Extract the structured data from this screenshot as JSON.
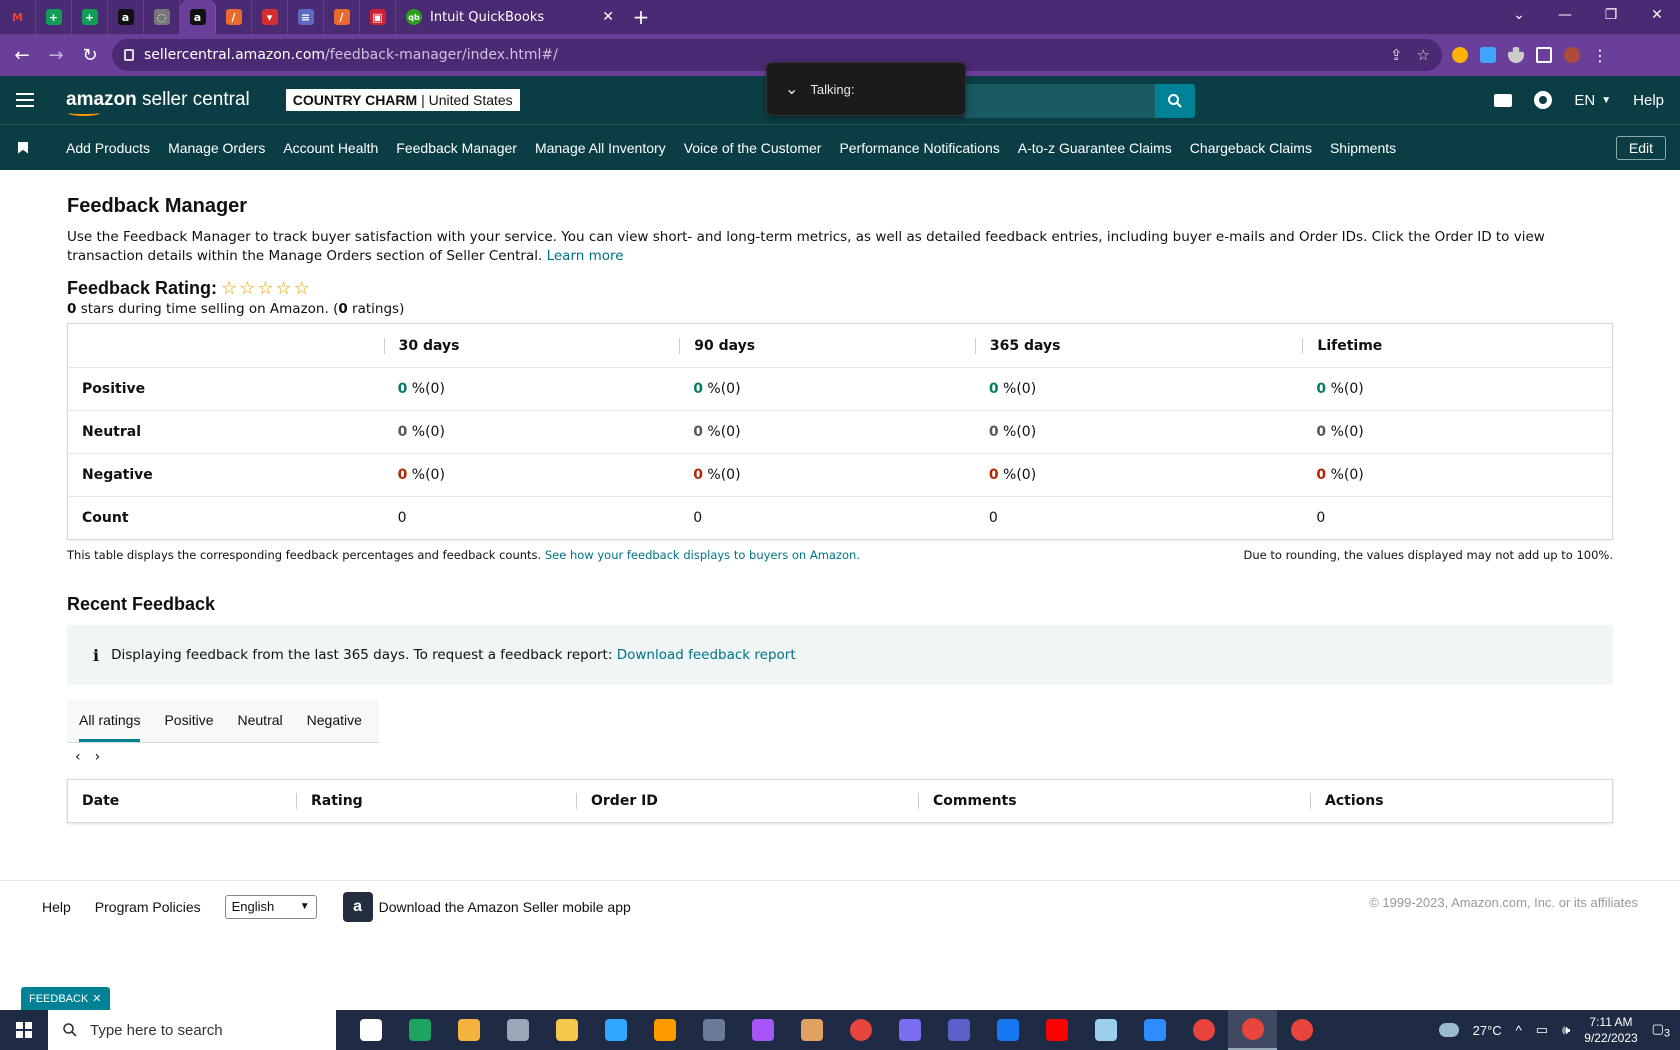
{
  "browser": {
    "active_tab_title": "Intuit QuickBooks",
    "url_host": "sellercentral.amazon.com",
    "url_path": "/feedback-manager/index.html#/",
    "mini_tabs": [
      {
        "icon": "gmail-icon",
        "color": "#ffffff",
        "glyph": "M"
      },
      {
        "icon": "sheets-icon",
        "color": "#0f9d58",
        "glyph": "+"
      },
      {
        "icon": "sheets-icon",
        "color": "#0f9d58",
        "glyph": "+"
      },
      {
        "icon": "amazon-icon",
        "color": "#111111",
        "glyph": "a"
      },
      {
        "icon": "loading-icon",
        "color": "#777777",
        "glyph": "◌"
      },
      {
        "icon": "amazon-icon",
        "color": "#111111",
        "glyph": "a"
      },
      {
        "icon": "app-icon",
        "color": "#e86a2c",
        "glyph": "/"
      },
      {
        "icon": "app-icon",
        "color": "#d32f2f",
        "glyph": "▾"
      },
      {
        "icon": "list-icon",
        "color": "#5c6bc0",
        "glyph": "≡"
      },
      {
        "icon": "app-icon",
        "color": "#e86a2c",
        "glyph": "/"
      },
      {
        "icon": "app-icon",
        "color": "#cc2233",
        "glyph": "▣"
      }
    ]
  },
  "header": {
    "logo_bold": "amazon",
    "logo_rest": " seller central",
    "store_name": "COUNTRY CHARM",
    "store_region": "United States",
    "lang": "EN",
    "help": "Help",
    "talking": "Talking:"
  },
  "nav": {
    "items": [
      "Add Products",
      "Manage Orders",
      "Account Health",
      "Feedback Manager",
      "Manage All Inventory",
      "Voice of the Customer",
      "Performance Notifications",
      "A-to-z Guarantee Claims",
      "Chargeback Claims",
      "Shipments"
    ],
    "edit": "Edit"
  },
  "page": {
    "title": "Feedback Manager",
    "intro": "Use the Feedback Manager to track buyer satisfaction with your service. You can view short- and long-term metrics, as well as detailed feedback entries, including buyer e-mails and Order IDs. Click the Order ID to view transaction details within the Manage Orders section of Seller Central.",
    "learn_more": "Learn more",
    "rating_title": "Feedback Rating:",
    "stars_count": "0",
    "stars_text": " stars during time selling on Amazon. (",
    "ratings_count": "0",
    "ratings_text": " ratings)"
  },
  "feedback_table": {
    "headers": [
      "",
      "30 days",
      "90 days",
      "365 days",
      "Lifetime"
    ],
    "rows": [
      {
        "label": "Positive",
        "cls": "pos",
        "values": [
          "0",
          "0",
          "0",
          "0"
        ],
        "suffix": " %(0)"
      },
      {
        "label": "Neutral",
        "cls": "neu",
        "values": [
          "0",
          "0",
          "0",
          "0"
        ],
        "suffix": " %(0)"
      },
      {
        "label": "Negative",
        "cls": "neg",
        "values": [
          "0",
          "0",
          "0",
          "0"
        ],
        "suffix": " %(0)"
      },
      {
        "label": "Count",
        "cls": "",
        "values": [
          "0",
          "0",
          "0",
          "0"
        ],
        "suffix": ""
      }
    ],
    "note_left": "This table displays the corresponding feedback percentages and feedback counts.",
    "note_link": "See how your feedback displays to buyers on Amazon.",
    "note_right": "Due to rounding, the values displayed may not add up to 100%."
  },
  "recent": {
    "title": "Recent Feedback",
    "info": "Displaying feedback from the last 365 days. To request a feedback report:",
    "info_link": "Download feedback report",
    "tabs": [
      "All ratings",
      "Positive",
      "Neutral",
      "Negative"
    ],
    "active_tab": "All ratings",
    "columns": [
      "Date",
      "Rating",
      "Order ID",
      "Comments",
      "Actions"
    ]
  },
  "footer": {
    "help": "Help",
    "policies": "Program Policies",
    "language": "English",
    "app_text": "Download the Amazon Seller mobile app",
    "copyright": "© 1999-2023, Amazon.com, Inc. or its affiliates",
    "feedback_tab": "FEEDBACK"
  },
  "taskbar": {
    "search_placeholder": "Type here to search",
    "temperature": "27°C",
    "time": "7:11 AM",
    "date": "9/22/2023",
    "notification_count": "3",
    "apps": [
      {
        "name": "task-view-icon",
        "color": "#ffffff"
      },
      {
        "name": "edge-icon",
        "color": "#1da462"
      },
      {
        "name": "store-icon",
        "color": "#f3b33d"
      },
      {
        "name": "camera-icon",
        "color": "#9aa7b8"
      },
      {
        "name": "explorer-icon",
        "color": "#f2c94c"
      },
      {
        "name": "photoshop-icon",
        "color": "#31a8ff"
      },
      {
        "name": "illustrator-icon",
        "color": "#ff9a00"
      },
      {
        "name": "calculator-icon",
        "color": "#6b7a99"
      },
      {
        "name": "messenger-icon",
        "color": "#a855f7"
      },
      {
        "name": "pen-icon",
        "color": "#e0a060"
      },
      {
        "name": "chrome-icon",
        "color": "#e8453c"
      },
      {
        "name": "app-icon",
        "color": "#7c6cf0"
      },
      {
        "name": "teams-icon",
        "color": "#5b5fc7"
      },
      {
        "name": "facebook-icon",
        "color": "#1877f2"
      },
      {
        "name": "youtube-icon",
        "color": "#ff0000"
      },
      {
        "name": "notes-icon",
        "color": "#9ad0ec"
      },
      {
        "name": "zoom-icon",
        "color": "#2d8cff"
      },
      {
        "name": "chrome-icon",
        "color": "#e8453c"
      },
      {
        "name": "chrome-icon",
        "color": "#e8453c"
      },
      {
        "name": "chrome-icon",
        "color": "#e8453c"
      }
    ]
  }
}
